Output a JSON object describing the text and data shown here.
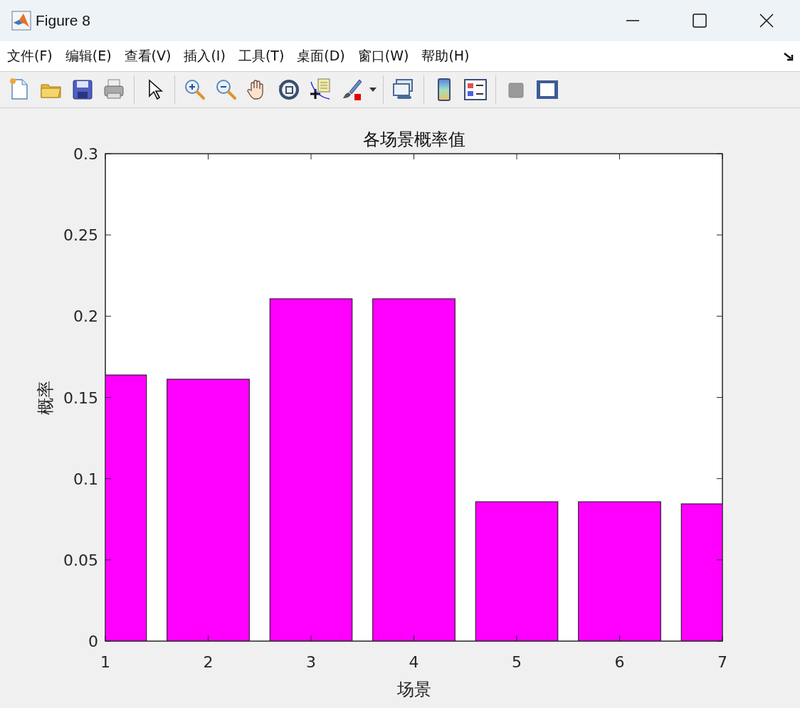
{
  "window": {
    "title": "Figure 8"
  },
  "menu": [
    {
      "label": "文件(F)"
    },
    {
      "label": "编辑(E)"
    },
    {
      "label": "查看(V)"
    },
    {
      "label": "插入(I)"
    },
    {
      "label": "工具(T)"
    },
    {
      "label": "桌面(D)"
    },
    {
      "label": "窗口(W)"
    },
    {
      "label": "帮助(H)"
    }
  ],
  "figure": {
    "chart_data": {
      "type": "bar",
      "title": "各场景概率值",
      "xlabel": "场景",
      "ylabel": "概率",
      "x": [
        1,
        2,
        3,
        4,
        5,
        6,
        7
      ],
      "series": [
        {
          "color": "#ff00ff",
          "values": [
            0.1638,
            0.1612,
            0.2107,
            0.2107,
            0.0858,
            0.0858,
            0.0845
          ]
        }
      ],
      "xlim": [
        1,
        7
      ],
      "ylim": [
        0,
        0.3
      ],
      "xticks": [
        1,
        2,
        3,
        4,
        5,
        6,
        7
      ],
      "yticks": [
        0,
        0.05,
        0.1,
        0.15,
        0.2,
        0.25,
        0.3
      ]
    }
  }
}
